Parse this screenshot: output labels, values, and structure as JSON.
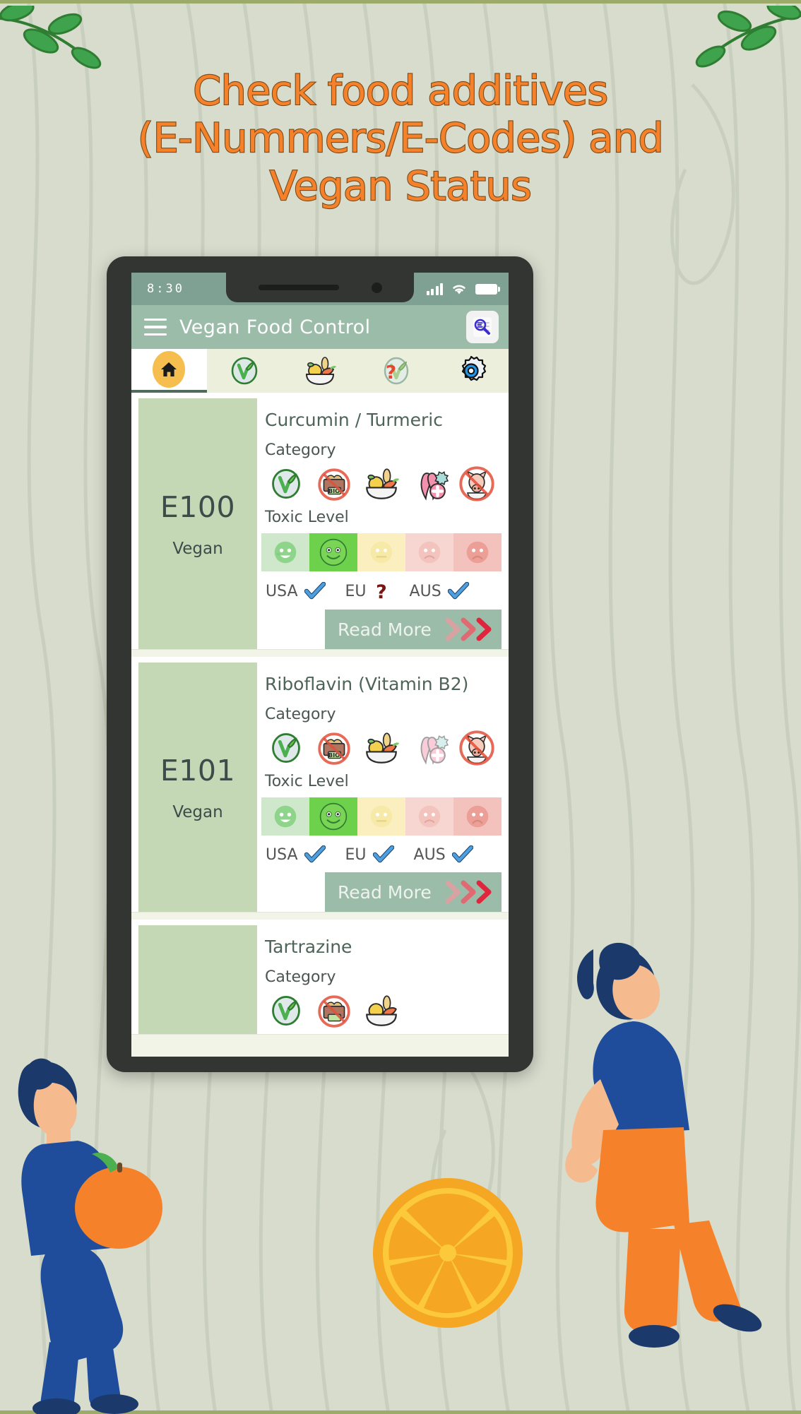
{
  "headline": {
    "line1": "Check food additives",
    "line2": "(E-Nummers/E-Codes) and",
    "line3": "Vegan Status",
    "color": "#F5822B",
    "stroke_color": "#7a4a18"
  },
  "background": {
    "color": "#d7dccd",
    "border_color": "#9cab6a",
    "texture": "wood-grain"
  },
  "phone": {
    "bezel_color": "#333533",
    "statusbar": {
      "time": "8:30",
      "background": "#7fa193",
      "icons": [
        "signal-bars-icon",
        "wifi-icon",
        "battery-icon"
      ]
    },
    "appbar": {
      "title": "Vegan Food Control",
      "background": "#9cbcaa",
      "menu_icon": "hamburger-menu-icon",
      "search_icon": "search-document-icon"
    },
    "tabs": [
      {
        "name": "home",
        "icon": "home-icon",
        "active": true
      },
      {
        "name": "vegan",
        "icon": "vegan-leaf-icon",
        "active": false
      },
      {
        "name": "food",
        "icon": "food-bowl-icon",
        "active": false
      },
      {
        "name": "vegan-unknown",
        "icon": "vegan-question-icon",
        "active": false
      },
      {
        "name": "settings",
        "icon": "gear-icon",
        "active": false
      }
    ],
    "navbar": {
      "icons": [
        "square-recents-icon",
        "circle-home-icon"
      ]
    }
  },
  "labels": {
    "category": "Category",
    "toxic_level": "Toxic Level",
    "read_more": "Read More"
  },
  "cards": [
    {
      "ecode": "E100",
      "status": "Vegan",
      "name": "Curcumin / Turmeric",
      "category_icons": [
        "vegan-ok-icon",
        "no-bio-icon",
        "food-bowl-icon",
        "health-ribbon-icon",
        "no-pork-icon"
      ],
      "category_states": [
        "active",
        "active",
        "active",
        "active",
        "active"
      ],
      "toxic_level": 2,
      "toxic_colors": [
        "#cfe8cb",
        "#6ed14b",
        "#fbefc0",
        "#f7d6d2",
        "#f3c2bd"
      ],
      "countries": [
        {
          "code": "USA",
          "status": "approved"
        },
        {
          "code": "EU",
          "status": "unknown"
        },
        {
          "code": "AUS",
          "status": "approved"
        }
      ]
    },
    {
      "ecode": "E101",
      "status": "Vegan",
      "name": "Riboflavin (Vitamin B2)",
      "category_icons": [
        "vegan-ok-icon",
        "no-bio-icon",
        "food-bowl-icon",
        "health-ribbon-icon",
        "no-pork-icon"
      ],
      "category_states": [
        "active",
        "active",
        "active",
        "faded",
        "active"
      ],
      "toxic_level": 2,
      "toxic_colors": [
        "#cfe8cb",
        "#6ed14b",
        "#fbefc0",
        "#f7d6d2",
        "#f3c2bd"
      ],
      "countries": [
        {
          "code": "USA",
          "status": "approved"
        },
        {
          "code": "EU",
          "status": "approved"
        },
        {
          "code": "AUS",
          "status": "approved"
        }
      ]
    },
    {
      "ecode": "",
      "status": "",
      "name": "Tartrazine",
      "category_icons": [
        "vegan-ok-icon",
        "no-bio-icon",
        "food-bowl-icon"
      ],
      "category_states": [
        "active",
        "active",
        "active"
      ],
      "toxic_level": 0,
      "toxic_colors": [],
      "countries": []
    }
  ],
  "checkmark_color": "#3f8fd6",
  "question_color": "#7c1414",
  "accent_orange": "#F5822B"
}
